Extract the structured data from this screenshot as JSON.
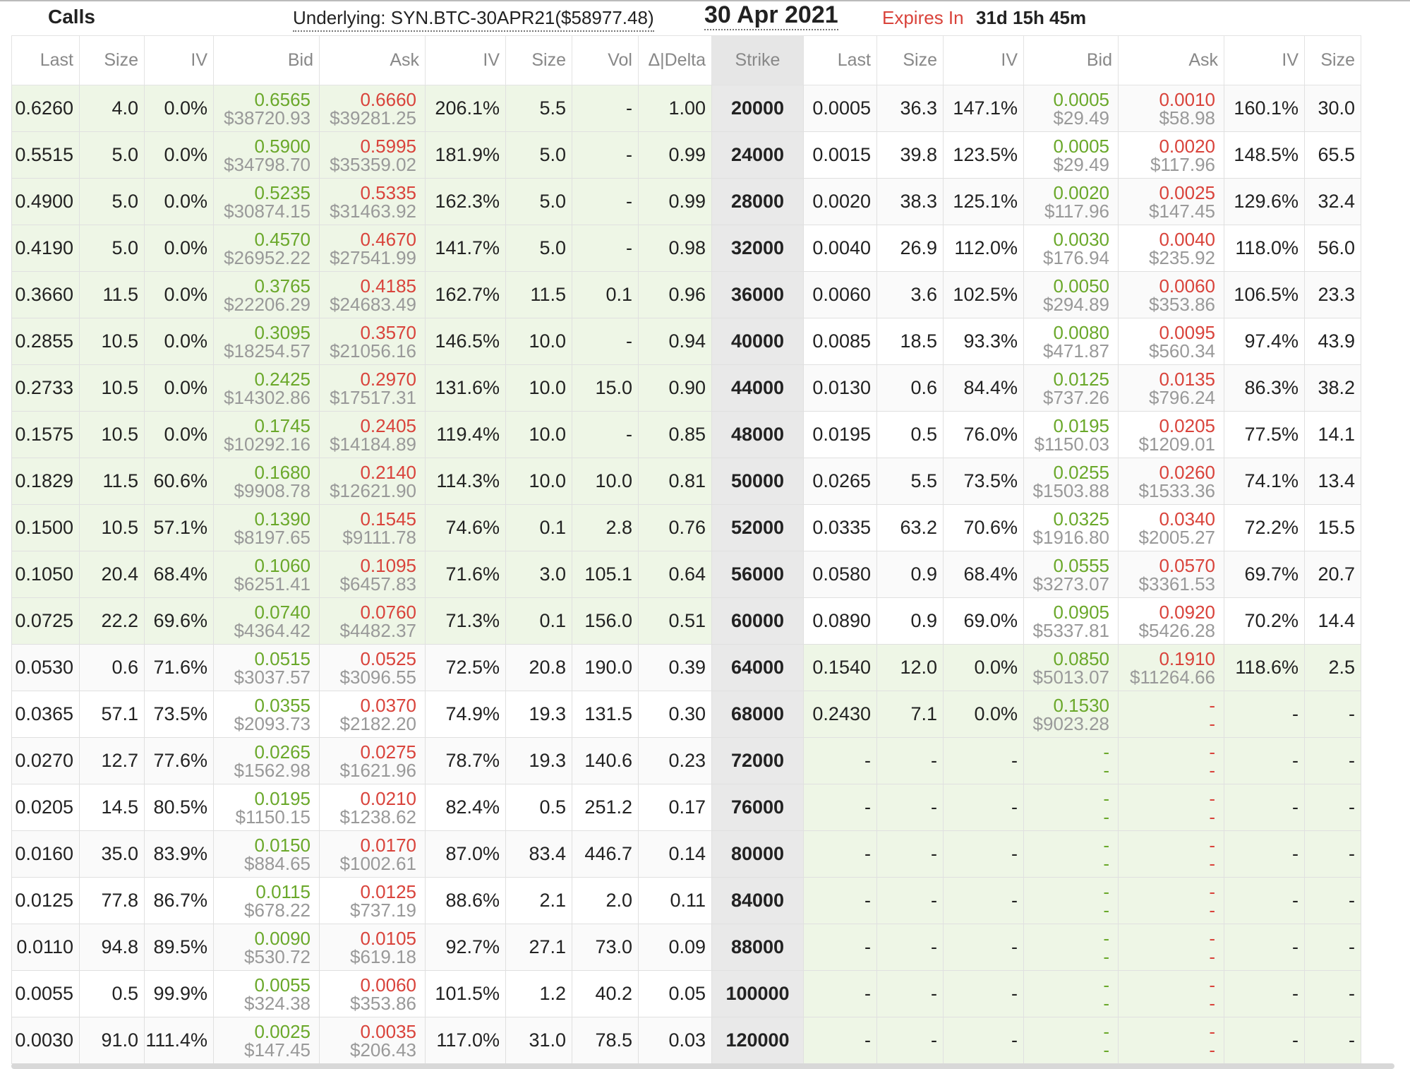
{
  "header": {
    "calls_label": "Calls",
    "underlying": "Underlying: SYN.BTC-30APR21($58977.48)",
    "expiry_date": "30 Apr 2021",
    "expires_label": "Expires In",
    "expires_value": "31d 15h 45m"
  },
  "columns": [
    "Last",
    "Size",
    "IV",
    "Bid",
    "Ask",
    "IV",
    "Size",
    "Vol",
    "Δ|Delta",
    "Strike",
    "Last",
    "Size",
    "IV",
    "Bid",
    "Ask",
    "IV",
    "Size"
  ],
  "rows": [
    {
      "c": [
        "0.6260",
        "4.0",
        "0.0%",
        "0.6565",
        "$38720.93",
        "0.6660",
        "$39281.25",
        "206.1%",
        "5.5",
        "-",
        "1.00"
      ],
      "strike": "20000",
      "p": [
        "0.0005",
        "36.3",
        "147.1%",
        "0.0005",
        "$29.49",
        "0.0010",
        "$58.98",
        "160.1%",
        "30.0"
      ]
    },
    {
      "c": [
        "0.5515",
        "5.0",
        "0.0%",
        "0.5900",
        "$34798.70",
        "0.5995",
        "$35359.02",
        "181.9%",
        "5.0",
        "-",
        "0.99"
      ],
      "strike": "24000",
      "p": [
        "0.0015",
        "39.8",
        "123.5%",
        "0.0005",
        "$29.49",
        "0.0020",
        "$117.96",
        "148.5%",
        "65.5"
      ]
    },
    {
      "c": [
        "0.4900",
        "5.0",
        "0.0%",
        "0.5235",
        "$30874.15",
        "0.5335",
        "$31463.92",
        "162.3%",
        "5.0",
        "-",
        "0.99"
      ],
      "strike": "28000",
      "p": [
        "0.0020",
        "38.3",
        "125.1%",
        "0.0020",
        "$117.96",
        "0.0025",
        "$147.45",
        "129.6%",
        "32.4"
      ]
    },
    {
      "c": [
        "0.4190",
        "5.0",
        "0.0%",
        "0.4570",
        "$26952.22",
        "0.4670",
        "$27541.99",
        "141.7%",
        "5.0",
        "-",
        "0.98"
      ],
      "strike": "32000",
      "p": [
        "0.0040",
        "26.9",
        "112.0%",
        "0.0030",
        "$176.94",
        "0.0040",
        "$235.92",
        "118.0%",
        "56.0"
      ]
    },
    {
      "c": [
        "0.3660",
        "11.5",
        "0.0%",
        "0.3765",
        "$22206.29",
        "0.4185",
        "$24683.49",
        "162.7%",
        "11.5",
        "0.1",
        "0.96"
      ],
      "strike": "36000",
      "p": [
        "0.0060",
        "3.6",
        "102.5%",
        "0.0050",
        "$294.89",
        "0.0060",
        "$353.86",
        "106.5%",
        "23.3"
      ]
    },
    {
      "c": [
        "0.2855",
        "10.5",
        "0.0%",
        "0.3095",
        "$18254.57",
        "0.3570",
        "$21056.16",
        "146.5%",
        "10.0",
        "-",
        "0.94"
      ],
      "strike": "40000",
      "p": [
        "0.0085",
        "18.5",
        "93.3%",
        "0.0080",
        "$471.87",
        "0.0095",
        "$560.34",
        "97.4%",
        "43.9"
      ]
    },
    {
      "c": [
        "0.2733",
        "10.5",
        "0.0%",
        "0.2425",
        "$14302.86",
        "0.2970",
        "$17517.31",
        "131.6%",
        "10.0",
        "15.0",
        "0.90"
      ],
      "strike": "44000",
      "p": [
        "0.0130",
        "0.6",
        "84.4%",
        "0.0125",
        "$737.26",
        "0.0135",
        "$796.24",
        "86.3%",
        "38.2"
      ]
    },
    {
      "c": [
        "0.1575",
        "10.5",
        "0.0%",
        "0.1745",
        "$10292.16",
        "0.2405",
        "$14184.89",
        "119.4%",
        "10.0",
        "-",
        "0.85"
      ],
      "strike": "48000",
      "p": [
        "0.0195",
        "0.5",
        "76.0%",
        "0.0195",
        "$1150.03",
        "0.0205",
        "$1209.01",
        "77.5%",
        "14.1"
      ]
    },
    {
      "c": [
        "0.1829",
        "11.5",
        "60.6%",
        "0.1680",
        "$9908.78",
        "0.2140",
        "$12621.90",
        "114.3%",
        "10.0",
        "10.0",
        "0.81"
      ],
      "strike": "50000",
      "p": [
        "0.0265",
        "5.5",
        "73.5%",
        "0.0255",
        "$1503.88",
        "0.0260",
        "$1533.36",
        "74.1%",
        "13.4"
      ]
    },
    {
      "c": [
        "0.1500",
        "10.5",
        "57.1%",
        "0.1390",
        "$8197.65",
        "0.1545",
        "$9111.78",
        "74.6%",
        "0.1",
        "2.8",
        "0.76"
      ],
      "strike": "52000",
      "p": [
        "0.0335",
        "63.2",
        "70.6%",
        "0.0325",
        "$1916.80",
        "0.0340",
        "$2005.27",
        "72.2%",
        "15.5"
      ]
    },
    {
      "c": [
        "0.1050",
        "20.4",
        "68.4%",
        "0.1060",
        "$6251.41",
        "0.1095",
        "$6457.83",
        "71.6%",
        "3.0",
        "105.1",
        "0.64"
      ],
      "strike": "56000",
      "p": [
        "0.0580",
        "0.9",
        "68.4%",
        "0.0555",
        "$3273.07",
        "0.0570",
        "$3361.53",
        "69.7%",
        "20.7"
      ]
    },
    {
      "c": [
        "0.0725",
        "22.2",
        "69.6%",
        "0.0740",
        "$4364.42",
        "0.0760",
        "$4482.37",
        "71.3%",
        "0.1",
        "156.0",
        "0.51"
      ],
      "strike": "60000",
      "p": [
        "0.0890",
        "0.9",
        "69.0%",
        "0.0905",
        "$5337.81",
        "0.0920",
        "$5426.28",
        "70.2%",
        "14.4"
      ]
    },
    {
      "c": [
        "0.0530",
        "0.6",
        "71.6%",
        "0.0515",
        "$3037.57",
        "0.0525",
        "$3096.55",
        "72.5%",
        "20.8",
        "190.0",
        "0.39"
      ],
      "strike": "64000",
      "p": [
        "0.1540",
        "12.0",
        "0.0%",
        "0.0850",
        "$5013.07",
        "0.1910",
        "$11264.66",
        "118.6%",
        "2.5"
      ]
    },
    {
      "c": [
        "0.0365",
        "57.1",
        "73.5%",
        "0.0355",
        "$2093.73",
        "0.0370",
        "$2182.20",
        "74.9%",
        "19.3",
        "131.5",
        "0.30"
      ],
      "strike": "68000",
      "p": [
        "0.2430",
        "7.1",
        "0.0%",
        "0.1530",
        "$9023.28",
        "-",
        "-",
        "-",
        "-"
      ]
    },
    {
      "c": [
        "0.0270",
        "12.7",
        "77.6%",
        "0.0265",
        "$1562.98",
        "0.0275",
        "$1621.96",
        "78.7%",
        "19.3",
        "140.6",
        "0.23"
      ],
      "strike": "72000",
      "p": [
        "-",
        "-",
        "-",
        "-",
        "-",
        "-",
        "-",
        "-",
        "-"
      ]
    },
    {
      "c": [
        "0.0205",
        "14.5",
        "80.5%",
        "0.0195",
        "$1150.15",
        "0.0210",
        "$1238.62",
        "82.4%",
        "0.5",
        "251.2",
        "0.17"
      ],
      "strike": "76000",
      "p": [
        "-",
        "-",
        "-",
        "-",
        "-",
        "-",
        "-",
        "-",
        "-"
      ]
    },
    {
      "c": [
        "0.0160",
        "35.0",
        "83.9%",
        "0.0150",
        "$884.65",
        "0.0170",
        "$1002.61",
        "87.0%",
        "83.4",
        "446.7",
        "0.14"
      ],
      "strike": "80000",
      "p": [
        "-",
        "-",
        "-",
        "-",
        "-",
        "-",
        "-",
        "-",
        "-"
      ]
    },
    {
      "c": [
        "0.0125",
        "77.8",
        "86.7%",
        "0.0115",
        "$678.22",
        "0.0125",
        "$737.19",
        "88.6%",
        "2.1",
        "2.0",
        "0.11"
      ],
      "strike": "84000",
      "p": [
        "-",
        "-",
        "-",
        "-",
        "-",
        "-",
        "-",
        "-",
        "-"
      ]
    },
    {
      "c": [
        "0.0110",
        "94.8",
        "89.5%",
        "0.0090",
        "$530.72",
        "0.0105",
        "$619.18",
        "92.7%",
        "27.1",
        "73.0",
        "0.09"
      ],
      "strike": "88000",
      "p": [
        "-",
        "-",
        "-",
        "-",
        "-",
        "-",
        "-",
        "-",
        "-"
      ]
    },
    {
      "c": [
        "0.0055",
        "0.5",
        "99.9%",
        "0.0055",
        "$324.38",
        "0.0060",
        "$353.86",
        "101.5%",
        "1.2",
        "40.2",
        "0.05"
      ],
      "strike": "100000",
      "p": [
        "-",
        "-",
        "-",
        "-",
        "-",
        "-",
        "-",
        "-",
        "-"
      ]
    },
    {
      "c": [
        "0.0030",
        "91.0",
        "111.4%",
        "0.0025",
        "$147.45",
        "0.0035",
        "$206.43",
        "117.0%",
        "31.0",
        "78.5",
        "0.03"
      ],
      "strike": "120000",
      "p": [
        "-",
        "-",
        "-",
        "-",
        "-",
        "-",
        "-",
        "-",
        "-"
      ]
    }
  ]
}
